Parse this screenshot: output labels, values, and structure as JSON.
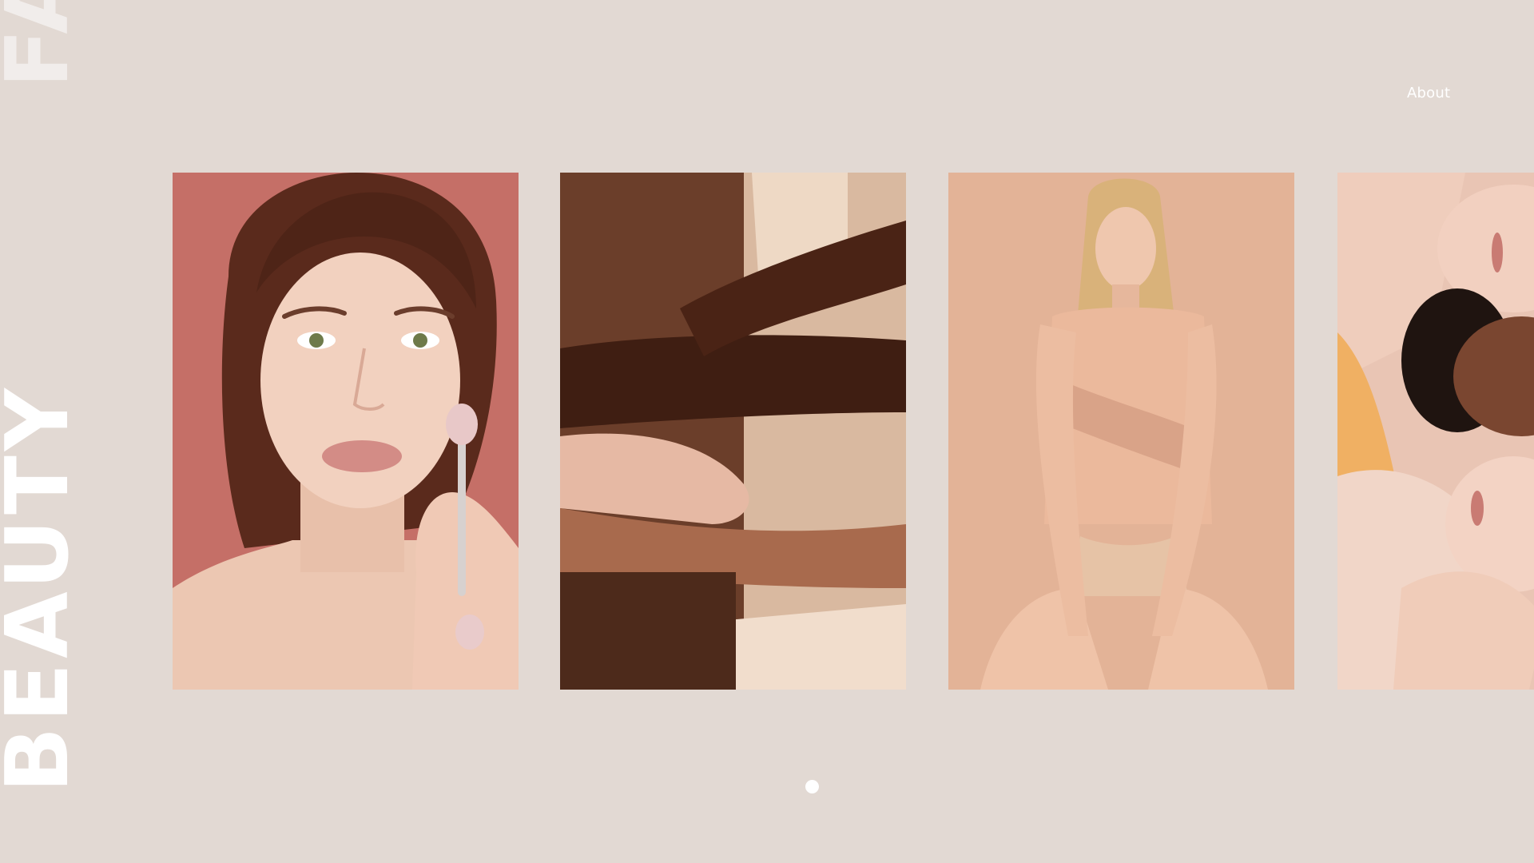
{
  "brand": {
    "vertical_text_main": "BEAUTY",
    "vertical_text_top": "FA"
  },
  "nav": {
    "about_label": "About"
  },
  "gallery": {
    "images": [
      {
        "name": "portrait-face-roller"
      },
      {
        "name": "intertwined-arms"
      },
      {
        "name": "seated-model"
      },
      {
        "name": "group-of-faces"
      }
    ]
  },
  "pager": {
    "active_index": 0,
    "count": 1
  },
  "colors": {
    "background": "#e2d9d3",
    "text": "#ffffff",
    "photo1_bg": "#c56f67",
    "photo2_bg": "#5a3222",
    "photo3_bg": "#e3b397",
    "photo4_bg": "#e9c5b4"
  }
}
